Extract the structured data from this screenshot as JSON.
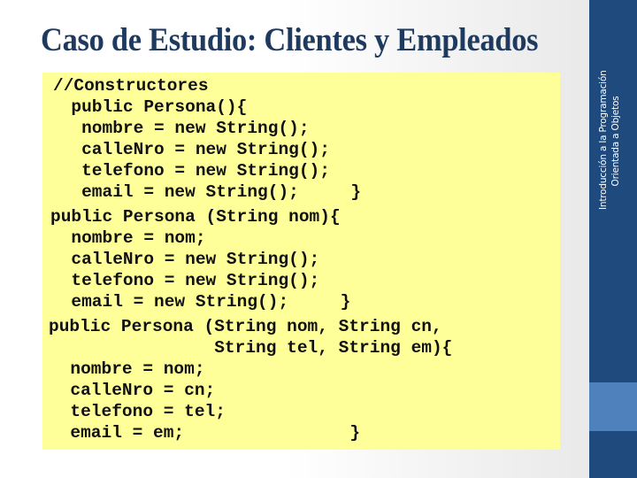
{
  "slide": {
    "title": "Caso de Estudio: Clientes y Empleados",
    "sidebar": {
      "course_line_1": "Introducción a la Programación",
      "course_line_2": "Orientada a Objetos"
    },
    "code": {
      "language": "Java",
      "lines": [
        "//Constructores",
        "  public Persona(){",
        "   nombre = new String();",
        "   calleNro = new String();",
        "   telefono = new String();",
        "   email = new String();     }",
        "public Persona (String nom){",
        "  nombre = nom;",
        "  calleNro = new String();",
        "  telefono = new String();",
        "  email = new String();     }",
        "public Persona (String nom, String cn,",
        "                String tel, String em){",
        "  nombre = nom;",
        "  calleNro = cn;",
        "  telefono = tel;",
        "  email = em;                }"
      ]
    },
    "colors": {
      "title": "#1f3a5f",
      "code_background": "#ffff99",
      "sidebar": "#1f4a7e",
      "sidebar_accent": "#4f81bd"
    }
  }
}
